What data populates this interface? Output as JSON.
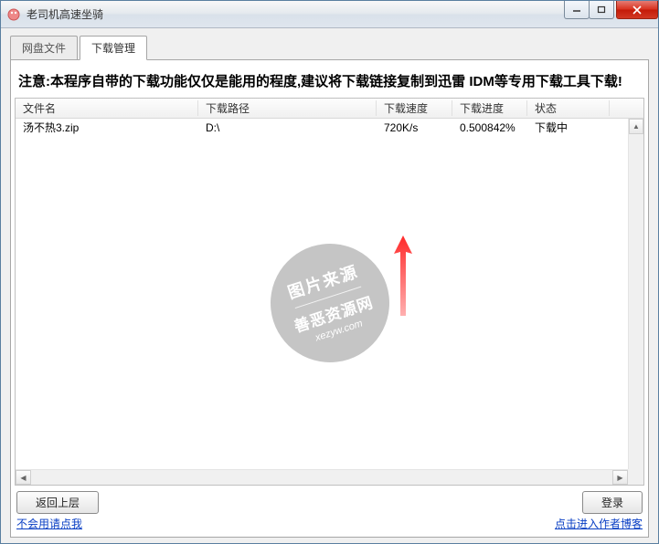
{
  "window": {
    "title": "老司机高速坐骑"
  },
  "tabs": [
    {
      "label": "网盘文件",
      "active": false
    },
    {
      "label": "下载管理",
      "active": true
    }
  ],
  "warning_text": "注意:本程序自带的下载功能仅仅是能用的程度,建议将下载链接复制到迅雷 IDM等专用下载工具下载!",
  "table": {
    "columns": {
      "name": "文件名",
      "path": "下载路径",
      "speed": "下载速度",
      "progress": "下载进度",
      "status": "状态"
    },
    "rows": [
      {
        "name": "汤不热3.zip",
        "path": "D:\\",
        "speed": "720K/s",
        "progress": "0.500842%",
        "status": "下载中"
      }
    ]
  },
  "buttons": {
    "back": "返回上层",
    "login": "登录"
  },
  "links": {
    "help": "不会用请点我",
    "blog": "点击进入作者博客"
  },
  "watermark": {
    "line1": "图片来源",
    "line2": "善恶资源网",
    "line3": "xezyw.com"
  }
}
